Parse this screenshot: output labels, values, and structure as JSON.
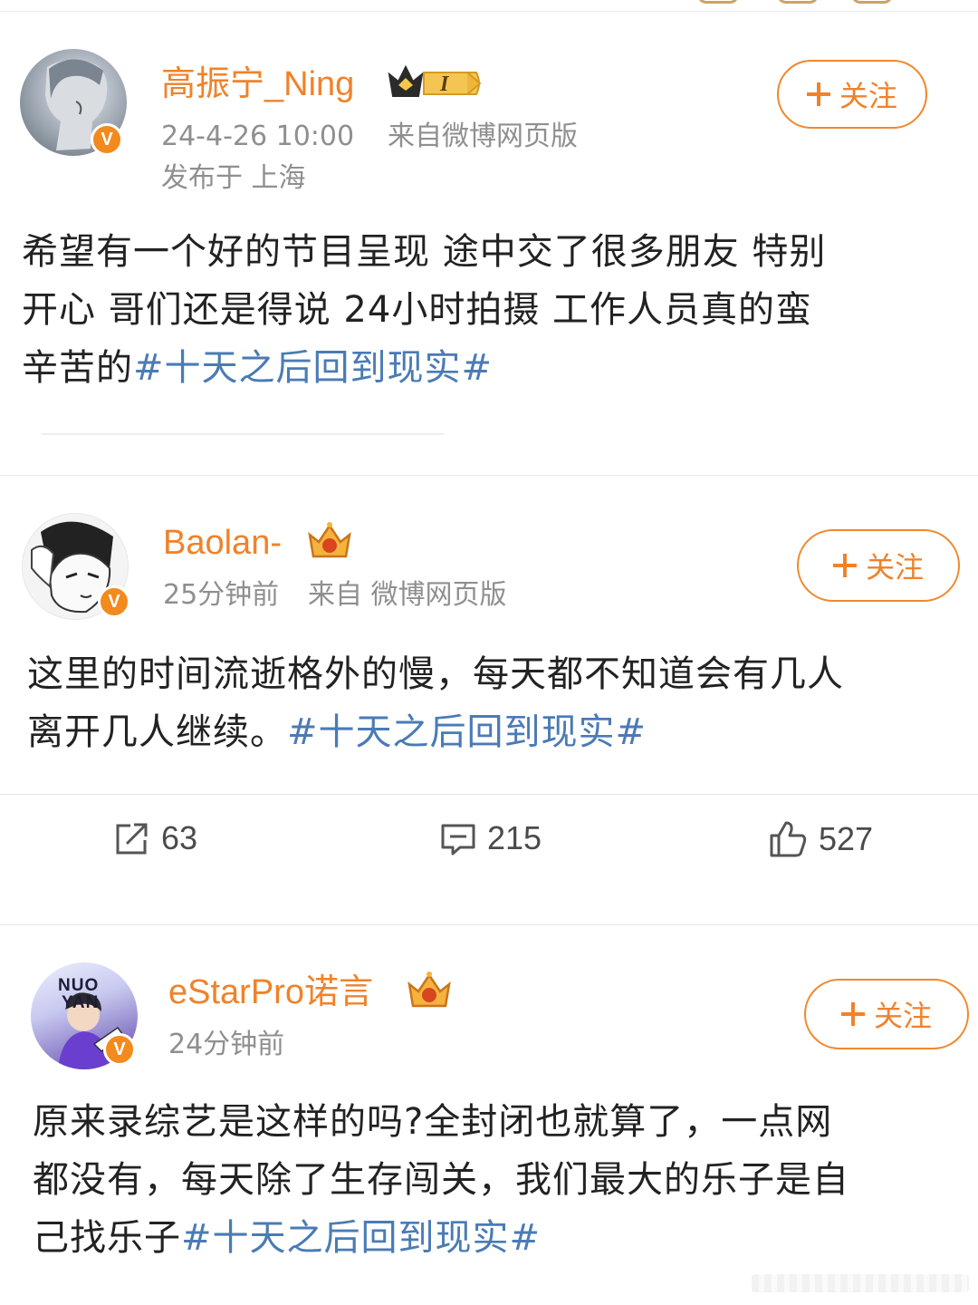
{
  "colors": {
    "accent": "#f0822a",
    "hashtag": "#4a7bb5",
    "meta": "#8f8f8f",
    "vbadge": "#f28a1e"
  },
  "posts": [
    {
      "username": "高振宁_Ning",
      "badge_level": "I",
      "time": "24-4-26 10:00",
      "source": "来自微博网页版",
      "location": "发布于 上海",
      "follow_label": "关注",
      "verify_mark": "V",
      "text_lines": [
        "希望有一个好的节目呈现  途中交了很多朋友 特别",
        "开心  哥们还是得说  24小时拍摄 工作人员真的蛮"
      ],
      "text_last": "辛苦的",
      "hashtag": "#十天之后回到现实#"
    },
    {
      "username": "Baolan-",
      "time": "25分钟前",
      "source": "来自 微博网页版",
      "follow_label": "关注",
      "verify_mark": "V",
      "text_lines": [
        "这里的时间流逝格外的慢，每天都不知道会有几人"
      ],
      "text_last": "离开几人继续。",
      "hashtag": "#十天之后回到现实#"
    },
    {
      "username": "eStarPro诺言",
      "time": "24分钟前",
      "follow_label": "关注",
      "verify_mark": "V",
      "avatar_text": [
        "NUO",
        "YAN"
      ],
      "text_lines": [
        "原来录综艺是这样的吗?全封闭也就算了，一点网",
        "都没有，每天除了生存闯关，我们最大的乐子是自"
      ],
      "text_last": "己找乐子",
      "hashtag": "#十天之后回到现实#"
    }
  ],
  "actions": {
    "repost_count": "63",
    "comment_count": "215",
    "like_count": "527",
    "icons": [
      "share-icon",
      "comment-icon",
      "like-icon"
    ]
  }
}
